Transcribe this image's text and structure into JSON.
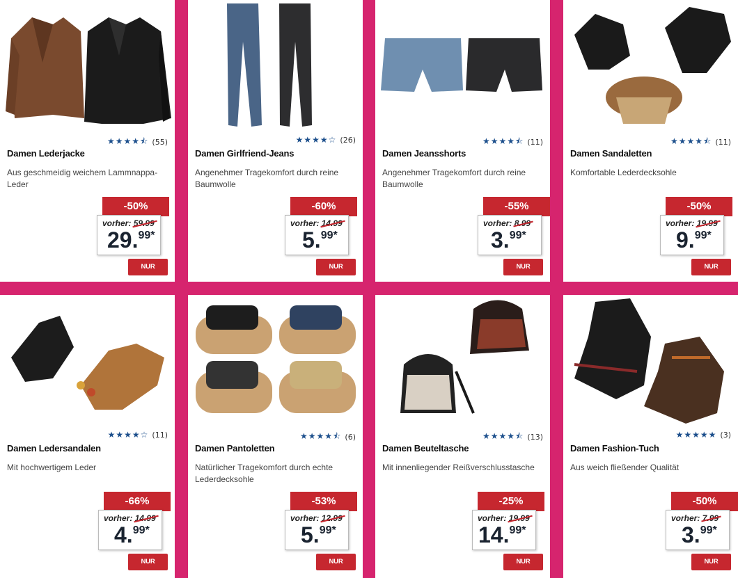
{
  "products": [
    {
      "title": "Damen Lederjacke",
      "desc": "Aus geschmeidig weichem Lammnappa-Leder",
      "stars": 4.5,
      "stars_text": "★★★★⯪",
      "count": "(55)",
      "discount": "-50%",
      "old_label": "vorher:",
      "old_price": "59.99",
      "price_int": "29.",
      "price_dec": "99*",
      "online": "NUR ONLINE",
      "image": "jacket-icon"
    },
    {
      "title": "Damen Girlfriend-Jeans",
      "desc": "Angenehmer Tragekomfort durch reine Baumwolle",
      "stars": 4,
      "stars_text": "★★★★☆",
      "count": "(26)",
      "discount": "-60%",
      "old_label": "vorher:",
      "old_price": "14.99",
      "price_int": "5.",
      "price_dec": "99*",
      "online": "NUR ONLINE",
      "image": "jeans-icon"
    },
    {
      "title": "Damen Jeansshorts",
      "desc": "Angenehmer Tragekomfort durch reine Baumwolle",
      "stars": 4.5,
      "stars_text": "★★★★⯪",
      "count": "(11)",
      "discount": "-55%",
      "old_label": "vorher:",
      "old_price": "8.99",
      "price_int": "3.",
      "price_dec": "99*",
      "online": "NUR ONLINE",
      "image": "shorts-icon"
    },
    {
      "title": "Damen Sandaletten",
      "desc": "Komfortable Lederdecksohle",
      "stars": 4.5,
      "stars_text": "★★★★⯪",
      "count": "(11)",
      "discount": "-50%",
      "old_label": "vorher:",
      "old_price": "19.99",
      "price_int": "9.",
      "price_dec": "99*",
      "online": "NUR ONLINE",
      "image": "wedge-sandal-icon"
    },
    {
      "title": "Damen Ledersandalen",
      "desc": "Mit hochwertigem Leder",
      "stars": 4,
      "stars_text": "★★★★☆",
      "count": "(11)",
      "discount": "-66%",
      "old_label": "vorher:",
      "old_price": "14.99",
      "price_int": "4.",
      "price_dec": "99*",
      "online": "NUR ONLINE",
      "image": "sandal-icon"
    },
    {
      "title": "Damen Pantoletten",
      "desc": "Natürlicher Tragekomfort durch echte Lederdecksohle",
      "stars": 4.5,
      "stars_text": "★★★★⯪",
      "count": "(6)",
      "discount": "-53%",
      "old_label": "vorher:",
      "old_price": "12.99",
      "price_int": "5.",
      "price_dec": "99*",
      "online": "NUR ONLINE",
      "image": "slide-icon"
    },
    {
      "title": "Damen Beuteltasche",
      "desc": "Mit innenliegender Reißverschlusstasche",
      "stars": 4.5,
      "stars_text": "★★★★⯪",
      "count": "(13)",
      "discount": "-25%",
      "old_label": "vorher:",
      "old_price": "19.99",
      "price_int": "14.",
      "price_dec": "99*",
      "online": "NUR ONLINE",
      "image": "bag-icon"
    },
    {
      "title": "Damen Fashion-Tuch",
      "desc": "Aus weich fließender Qualität",
      "stars": 5,
      "stars_text": "★★★★★",
      "count": "(3)",
      "discount": "-50%",
      "old_label": "vorher:",
      "old_price": "7.99",
      "price_int": "3.",
      "price_dec": "99*",
      "online": "NUR ONLINE",
      "image": "scarf-icon"
    }
  ],
  "colors": {
    "background": "#d6246e",
    "discount": "#c6272f",
    "star": "#1c4f8c"
  }
}
